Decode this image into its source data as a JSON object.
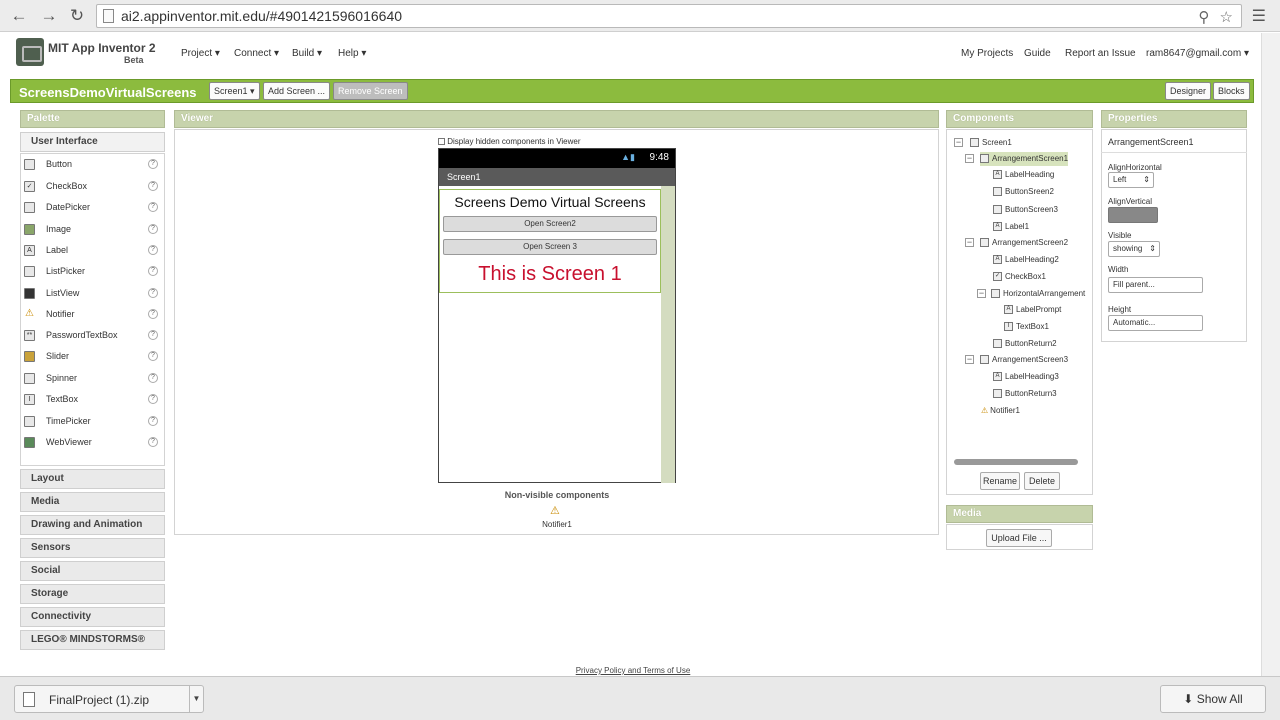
{
  "browser": {
    "url": "ai2.appinventor.mit.edu/#4901421596016640"
  },
  "header": {
    "app_name": "MIT App Inventor 2",
    "beta": "Beta",
    "menus": [
      "Project",
      "Connect",
      "Build",
      "Help"
    ],
    "right_links": [
      "My Projects",
      "Guide",
      "Report an Issue",
      "ram8647@gmail.com"
    ]
  },
  "toolbar": {
    "project_name": "ScreensDemoVirtualScreens",
    "screen_select": "Screen1",
    "add_screen": "Add Screen ...",
    "remove_screen": "Remove Screen",
    "designer": "Designer",
    "blocks": "Blocks"
  },
  "palette": {
    "title": "Palette",
    "category": "User Interface",
    "items": [
      "Button",
      "CheckBox",
      "DatePicker",
      "Image",
      "Label",
      "ListPicker",
      "ListView",
      "Notifier",
      "PasswordTextBox",
      "Slider",
      "Spinner",
      "TextBox",
      "TimePicker",
      "WebViewer"
    ],
    "categories": [
      "Layout",
      "Media",
      "Drawing and Animation",
      "Sensors",
      "Social",
      "Storage",
      "Connectivity",
      "LEGO® MINDSTORMS®"
    ]
  },
  "viewer": {
    "title": "Viewer",
    "hidden_checkbox_label": "Display hidden components in Viewer",
    "phone_time": "9:48",
    "screen_title": "Screen1",
    "heading": "Screens Demo Virtual Screens",
    "button1": "Open Screen2",
    "button2": "Open Screen 3",
    "big_label": "This is Screen 1",
    "nonvisible_title": "Non-visible components",
    "nonvisible_item": "Notifier1"
  },
  "components": {
    "title": "Components",
    "tree": [
      "Screen1",
      "ArrangementScreen1",
      "LabelHeading",
      "ButtonSreen2",
      "ButtonScreen3",
      "Label1",
      "ArrangementScreen2",
      "LabelHeading2",
      "CheckBox1",
      "HorizontalArrangement",
      "LabelPrompt",
      "TextBox1",
      "ButtonReturn2",
      "ArrangementScreen3",
      "LabelHeading3",
      "ButtonReturn3",
      "Notifier1"
    ],
    "rename": "Rename",
    "delete": "Delete"
  },
  "media": {
    "title": "Media",
    "upload": "Upload File ..."
  },
  "properties": {
    "title": "Properties",
    "component": "ArrangementScreen1",
    "align_h_label": "AlignHorizontal",
    "align_h_value": "Left",
    "align_v_label": "AlignVertical",
    "visible_label": "Visible",
    "visible_value": "showing",
    "width_label": "Width",
    "width_value": "Fill parent...",
    "height_label": "Height",
    "height_value": "Automatic..."
  },
  "footer": {
    "privacy": "Privacy Policy and Terms of Use"
  },
  "downloads": {
    "file": "FinalProject (1).zip",
    "show_all": "Show All"
  }
}
